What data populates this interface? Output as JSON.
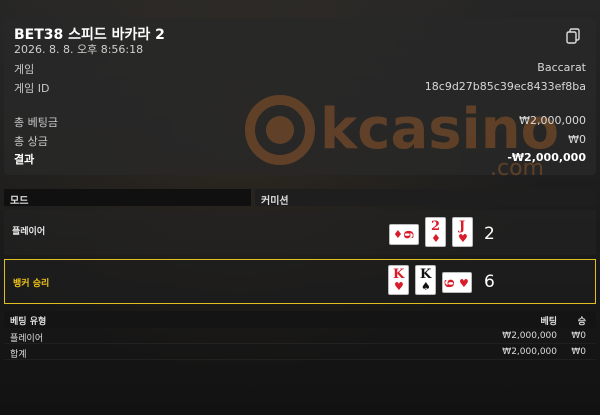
{
  "header": {
    "title": "BET38 스피드 바카라 2",
    "datetime": "2026. 8. 8. 오후 8:56:18"
  },
  "details": {
    "game_label": "게임",
    "game_value": "Baccarat",
    "game_id_label": "게임 ID",
    "game_id_value": "18c9d27b85c39ec8433ef8ba",
    "total_bet_label": "총 베팅금",
    "total_bet_value": "₩2,000,000",
    "total_win_label": "총 상금",
    "total_win_value": "₩0",
    "result_label": "결과",
    "result_value": "-₩2,000,000"
  },
  "watermark": {
    "text": "kcasino",
    "sub": ".com"
  },
  "sections": {
    "mode_label": "모드",
    "commission_label": "커미션"
  },
  "hands": {
    "player": {
      "label": "플레이어",
      "cards": [
        {
          "rank": "6",
          "suit": "♦",
          "color": "red",
          "orientation": "horizontal"
        },
        {
          "rank": "2",
          "suit": "♦",
          "color": "red",
          "orientation": "vertical"
        },
        {
          "rank": "J",
          "suit": "♥",
          "color": "red",
          "orientation": "vertical"
        }
      ],
      "score": "2"
    },
    "banker": {
      "label": "뱅커 승리",
      "cards": [
        {
          "rank": "K",
          "suit": "♥",
          "color": "red",
          "orientation": "vertical"
        },
        {
          "rank": "K",
          "suit": "♠",
          "color": "black",
          "orientation": "vertical"
        },
        {
          "rank": "6",
          "suit": "♥",
          "color": "red",
          "orientation": "horizontal"
        }
      ],
      "score": "6"
    }
  },
  "bets": {
    "headers": {
      "type": "베팅 유형",
      "bet": "베팅",
      "win": "승"
    },
    "rows": [
      {
        "type": "플레이어",
        "bet": "₩2,000,000",
        "win": "₩0"
      },
      {
        "type": "합계",
        "bet": "₩2,000,000",
        "win": "₩0"
      }
    ]
  },
  "colors": {
    "banker_highlight": "#f0c419",
    "card_red": "#d81c2a"
  }
}
